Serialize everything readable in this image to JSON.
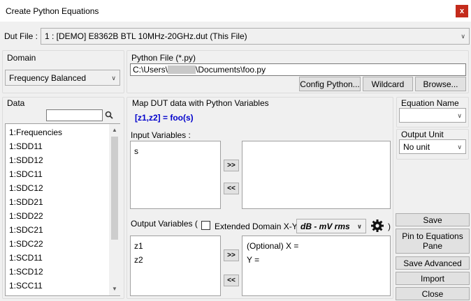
{
  "window": {
    "title": "Create Python Equations",
    "close_glyph": "x"
  },
  "dut": {
    "label": "Dut File :",
    "value": "1 : [DEMO] E8362B BTL 10MHz-20GHz.dut (This File)"
  },
  "domain": {
    "label": "Domain",
    "value": "Frequency Balanced"
  },
  "python_file": {
    "label": "Python File (*.py)",
    "path_prefix": "C:\\Users\\",
    "path_suffix": "\\Documents\\foo.py",
    "config_button": "Config Python...",
    "wildcard_button": "Wildcard",
    "browse_button": "Browse..."
  },
  "data": {
    "label": "Data",
    "search_value": "",
    "items": [
      "1:Frequencies",
      "1:SDD11",
      "1:SDD12",
      "1:SDC11",
      "1:SDC12",
      "1:SDD21",
      "1:SDD22",
      "1:SDC21",
      "1:SDC22",
      "1:SCD11",
      "1:SCD12",
      "1:SCC11"
    ]
  },
  "map": {
    "label": "Map DUT data with Python Variables",
    "signature": "[z1,z2] = foo(s)",
    "input_label": "Input Variables :",
    "input_vars": [
      "s"
    ],
    "add_btn": ">>",
    "remove_btn": "<<",
    "output_label": "Output Variables (",
    "extended_label": "Extended Domain X-Y",
    "unit_select": "dB - mV rms",
    "close_paren": ")",
    "output_vars": [
      "z1",
      "z2"
    ],
    "xy_lines": [
      "(Optional) X =",
      "Y ="
    ]
  },
  "equation": {
    "label": "Equation Name",
    "value": ""
  },
  "output_unit": {
    "label": "Output Unit",
    "value": "No unit"
  },
  "actions": {
    "save": "Save",
    "pin": "Pin to Equations Pane",
    "save_advanced": "Save Advanced",
    "import": "Import",
    "close": "Close"
  },
  "colors": {
    "accent": "#0000cc",
    "close": "#c42b1c"
  }
}
